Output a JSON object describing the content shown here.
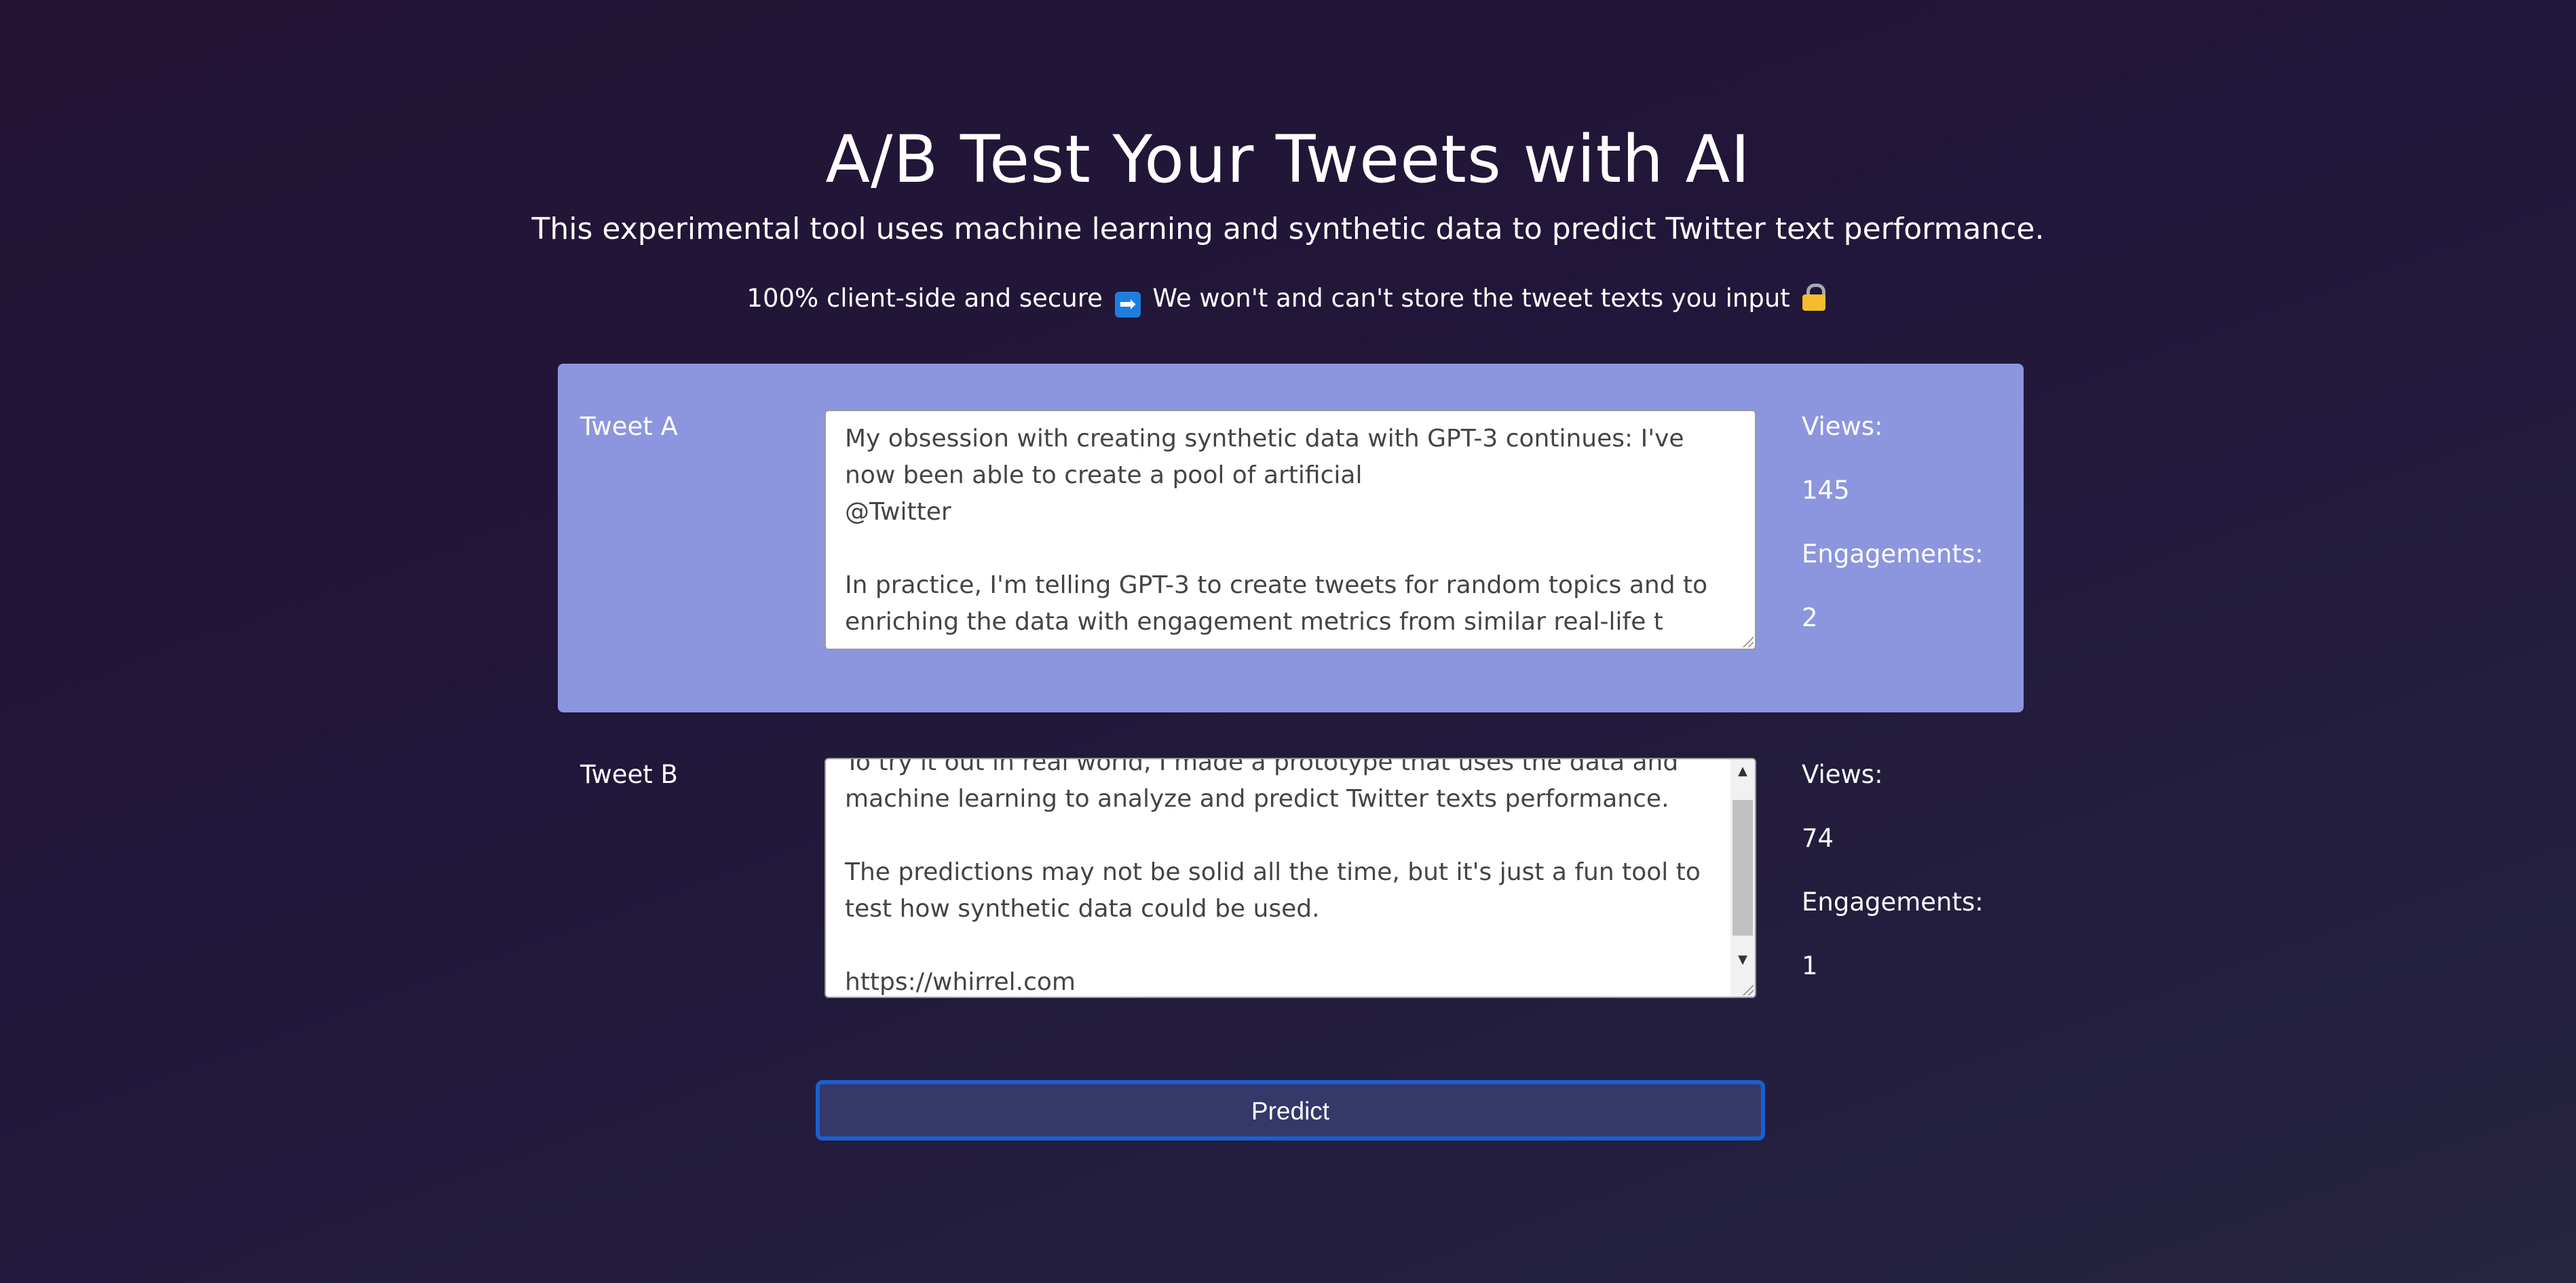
{
  "header": {
    "title": "A/B Test Your Tweets with AI",
    "subtitle": "This experimental tool uses machine learning and synthetic data to predict Twitter text performance.",
    "security_note_part1": "100% client-side and secure",
    "security_note_part2": "We won't and can't store the tweet texts you input",
    "security_icons": [
      "right-arrow-emoji",
      "lock-emoji"
    ]
  },
  "tweets": [
    {
      "label": "Tweet A",
      "text": "My obsession with creating synthetic data with GPT-3 continues: I've now been able to create a pool of artificial\n@Twitter\n\nIn practice, I'm telling GPT-3 to create tweets for random topics and to enriching the data with engagement metrics from similar real-life t",
      "views_label": "Views:",
      "views": "145",
      "engagements_label": "Engagements:",
      "engagements": "2"
    },
    {
      "label": "Tweet B",
      "text": "To try it out in real world, I made a prototype that uses the data and machine learning to analyze and predict Twitter texts performance.\n\nThe predictions may not be solid all the time, but it's just a fun tool to test how synthetic data could be used.\n\nhttps://whirrel.com",
      "views_label": "Views:",
      "views": "74",
      "engagements_label": "Engagements:",
      "engagements": "1"
    }
  ],
  "predict_button": {
    "label": "Predict"
  },
  "colors": {
    "background": "#231435",
    "tweet_a_panel": "#8c96de",
    "button_background": "#36386a",
    "button_border": "#1a5fd0"
  }
}
